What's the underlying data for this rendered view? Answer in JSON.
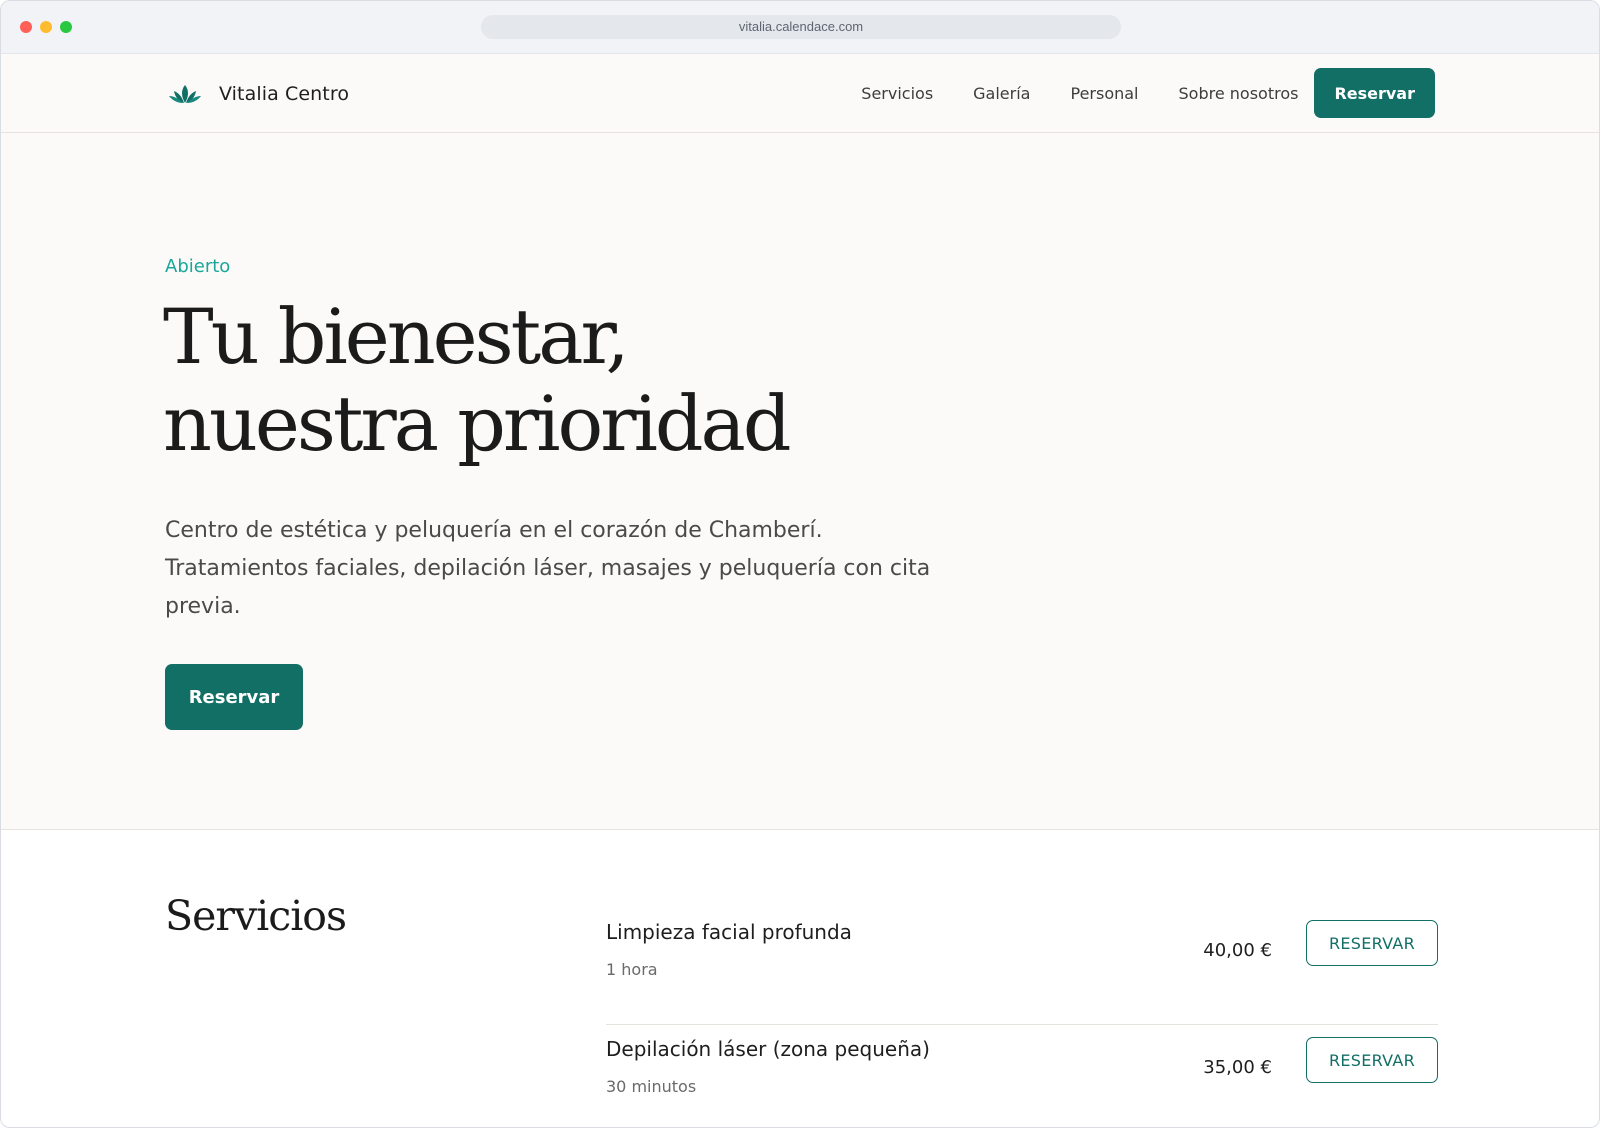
{
  "browser": {
    "url": "vitalia.calendace.com"
  },
  "header": {
    "brand_name": "Vitalia Centro",
    "brand_icon": "lotus-icon",
    "nav": [
      {
        "label": "Servicios"
      },
      {
        "label": "Galería"
      },
      {
        "label": "Personal"
      },
      {
        "label": "Sobre nosotros"
      }
    ],
    "cta_label": "Reservar"
  },
  "hero": {
    "status": "Abierto",
    "title_line1": "Tu bienestar,",
    "title_line2": "nuestra prioridad",
    "description": "Centro de estética y peluquería en el corazón de Chamberí. Tratamientos faciales, depilación láser, masajes y peluquería con cita previa.",
    "cta_label": "Reservar"
  },
  "services": {
    "title": "Servicios",
    "items": [
      {
        "name": "Limpieza facial profunda",
        "duration": "1 hora",
        "price": "40,00 €",
        "button": "RESERVAR"
      },
      {
        "name": "Depilación láser (zona pequeña)",
        "duration": "30 minutos",
        "price": "35,00 €",
        "button": "RESERVAR"
      }
    ]
  },
  "colors": {
    "primary": "#126f66",
    "status": "#1aa79a",
    "background": "#fbfaf8"
  }
}
